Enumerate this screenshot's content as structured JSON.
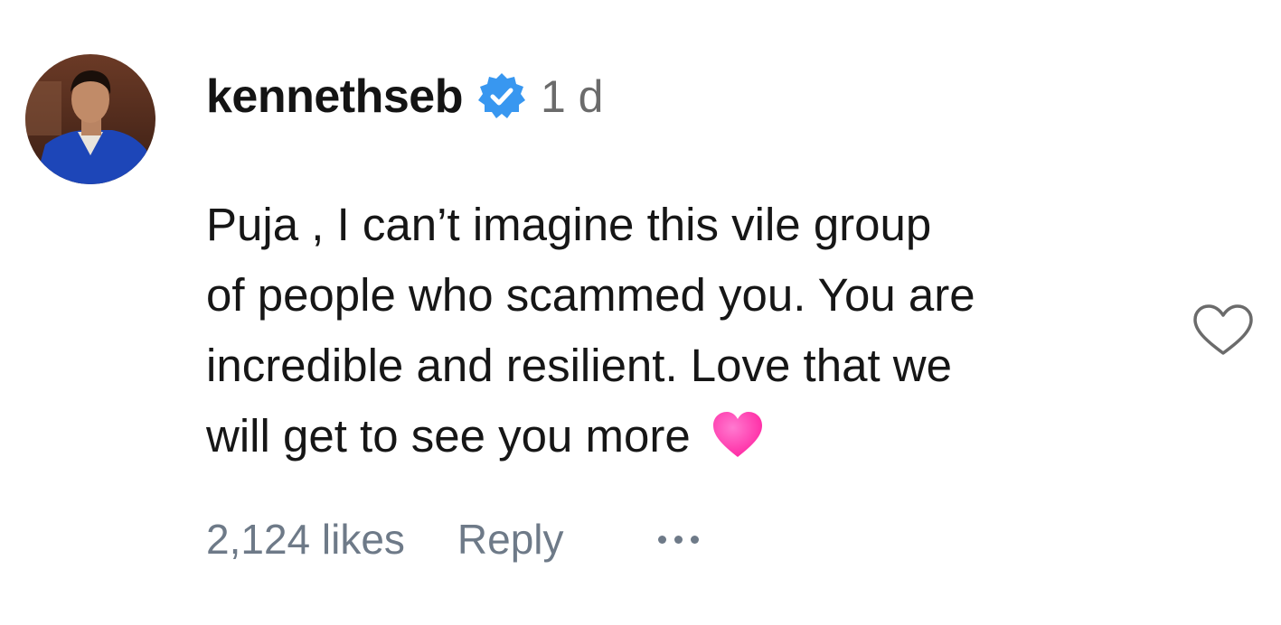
{
  "comment": {
    "username": "kennethseb",
    "verified": true,
    "timestamp": "1 d",
    "text_lines": [
      "Puja , I can’t imagine this vile group",
      "of people who scammed you. You are",
      "incredible and resilient. Love that we",
      "will get to see you more"
    ],
    "emoji": "pink-heart",
    "likes_label": "2,124 likes",
    "reply_label": "Reply"
  },
  "icons": {
    "verified": "verified-badge-icon",
    "like": "heart-outline-icon",
    "more": "more-options-icon"
  },
  "colors": {
    "verified_blue": "#3897f0",
    "meta_text": "#6e7a88",
    "emoji_pink": "#ff2fa8"
  }
}
